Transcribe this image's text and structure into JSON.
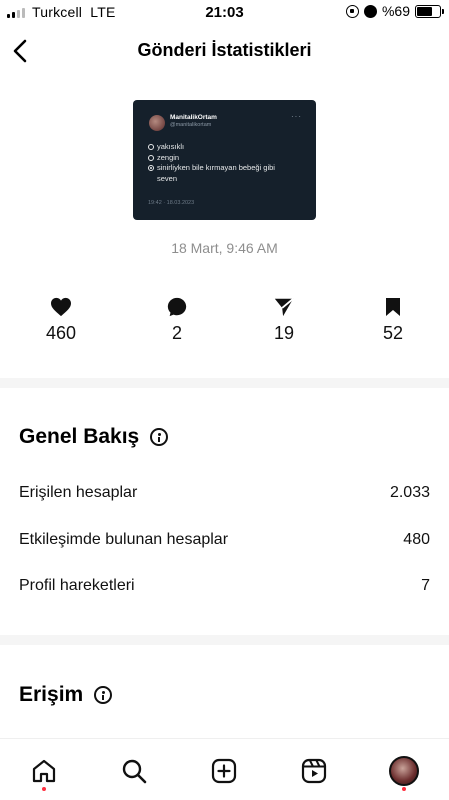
{
  "status_bar": {
    "carrier": "Turkcell",
    "network": "LTE",
    "time": "21:03",
    "battery_percent": "%69"
  },
  "header": {
    "title": "Gönderi İstatistikleri"
  },
  "post_preview": {
    "name": "ManitalikOrtam",
    "handle": "@manitalikortam",
    "options": [
      "yakısıklı",
      "zengin",
      "sinirliyken bile kırmayan bebeği gibi seven"
    ],
    "selected_option_index": 2,
    "timestamp": "19:42 · 18.03.2023",
    "background_color": "#15202b"
  },
  "post_date": "18 Mart, 9:46 AM",
  "metrics": {
    "likes": "460",
    "comments": "2",
    "shares": "19",
    "saves": "52"
  },
  "overview": {
    "title": "Genel Bakış",
    "rows": [
      {
        "label": "Erişilen hesaplar",
        "value": "2.033"
      },
      {
        "label": "Etkileşimde bulunan hesaplar",
        "value": "480"
      },
      {
        "label": "Profil hareketleri",
        "value": "7"
      }
    ]
  },
  "reach": {
    "title": "Erişim"
  },
  "bottom_nav": {
    "items": [
      "home-icon",
      "search-icon",
      "create-icon",
      "reels-icon",
      "profile-avatar"
    ],
    "notification_color": "#ff3040"
  }
}
